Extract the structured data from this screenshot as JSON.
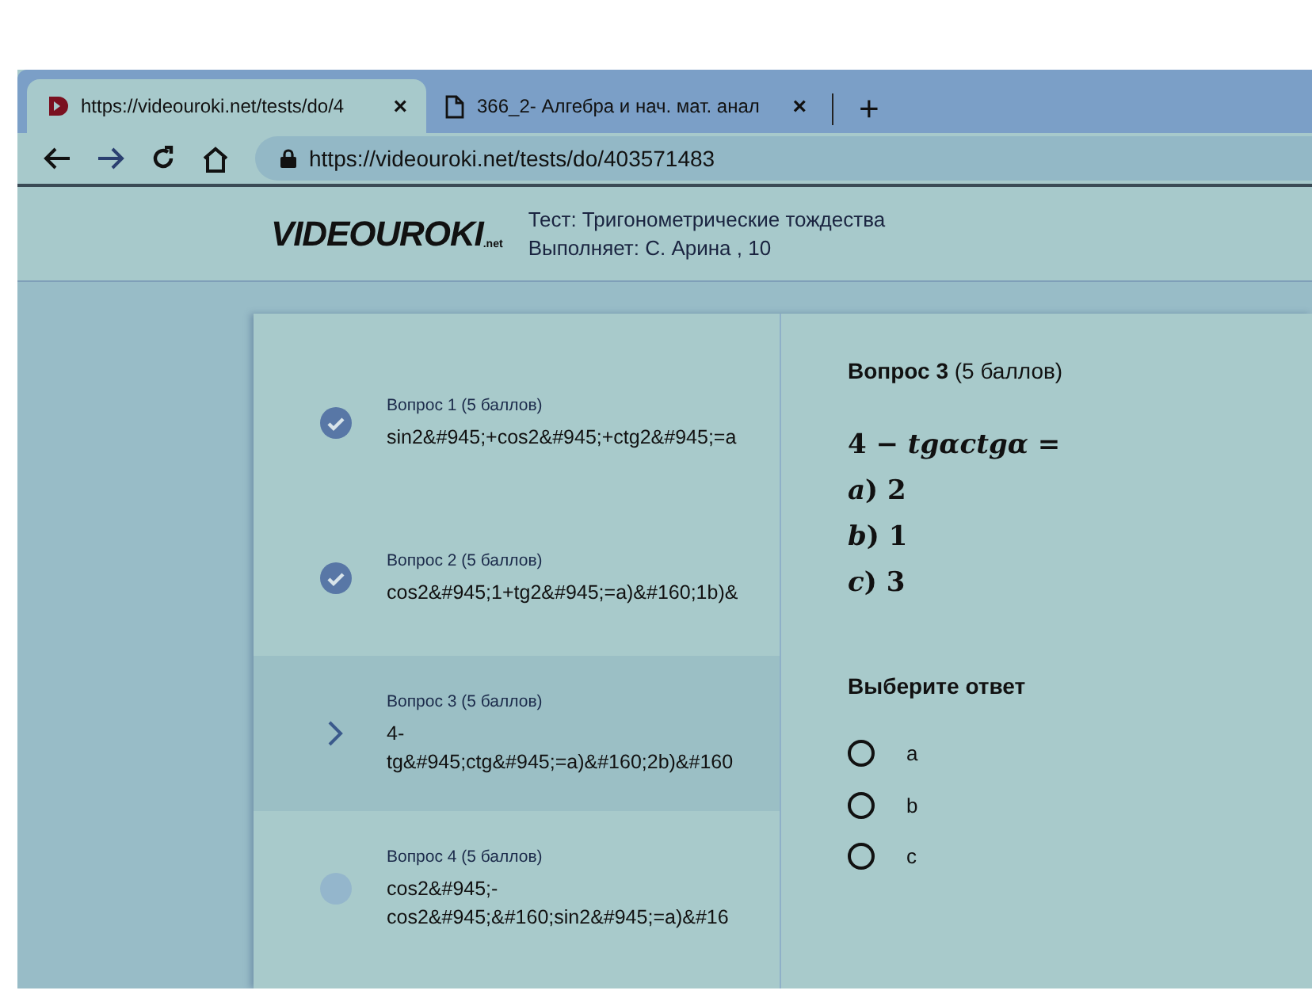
{
  "browser": {
    "tabs": [
      {
        "title": "https://videouroki.net/tests/do/4",
        "kind": "logo",
        "close": "×",
        "selected": true
      },
      {
        "title": "366_2- Алгебра и нач. мат. анал",
        "kind": "page",
        "close": "×",
        "selected": false
      }
    ],
    "new_tab": "+",
    "address": "https://videouroki.net/tests/do/403571483"
  },
  "header": {
    "logo": {
      "main": "VIDEOUROKI",
      "suffix": ".net"
    },
    "test_title": "Тест: Тригонометрические тождества",
    "student": "Выполняет: С. Арина , 10"
  },
  "questions": [
    {
      "title": "Вопрос 1 (5 баллов)",
      "lines": [
        "sin2&#945;+cos2&#945;+ctg2&#945;=a"
      ],
      "kind": "answered"
    },
    {
      "title": "Вопрос 2 (5 баллов)",
      "lines": [
        "cos2&#945;1+tg2&#945;=a)&#160;1b)&"
      ],
      "kind": "answered"
    },
    {
      "title": "Вопрос 3 (5 баллов)",
      "lines": [
        "4-",
        "tg&#945;ctg&#945;=a)&#160;2b)&#160"
      ],
      "kind": "current"
    },
    {
      "title": "Вопрос 4 (5 баллов)",
      "lines": [
        "cos2&#945;-",
        "cos2&#945;&#160;sin2&#945;=a)&#16"
      ],
      "kind": "unanswered"
    }
  ],
  "question": {
    "heading": "**Вопрос 3** (5 баллов)",
    "math_lines": [
      "4 − *tgαctgα* =",
      "*a*) 2",
      "*b*) 1",
      "*c*) 3"
    ],
    "prompt": "Выберите ответ",
    "options": [
      {
        "label": "a",
        "selected": false
      },
      {
        "label": "b",
        "selected": false
      },
      {
        "label": "c",
        "selected": false
      }
    ]
  }
}
